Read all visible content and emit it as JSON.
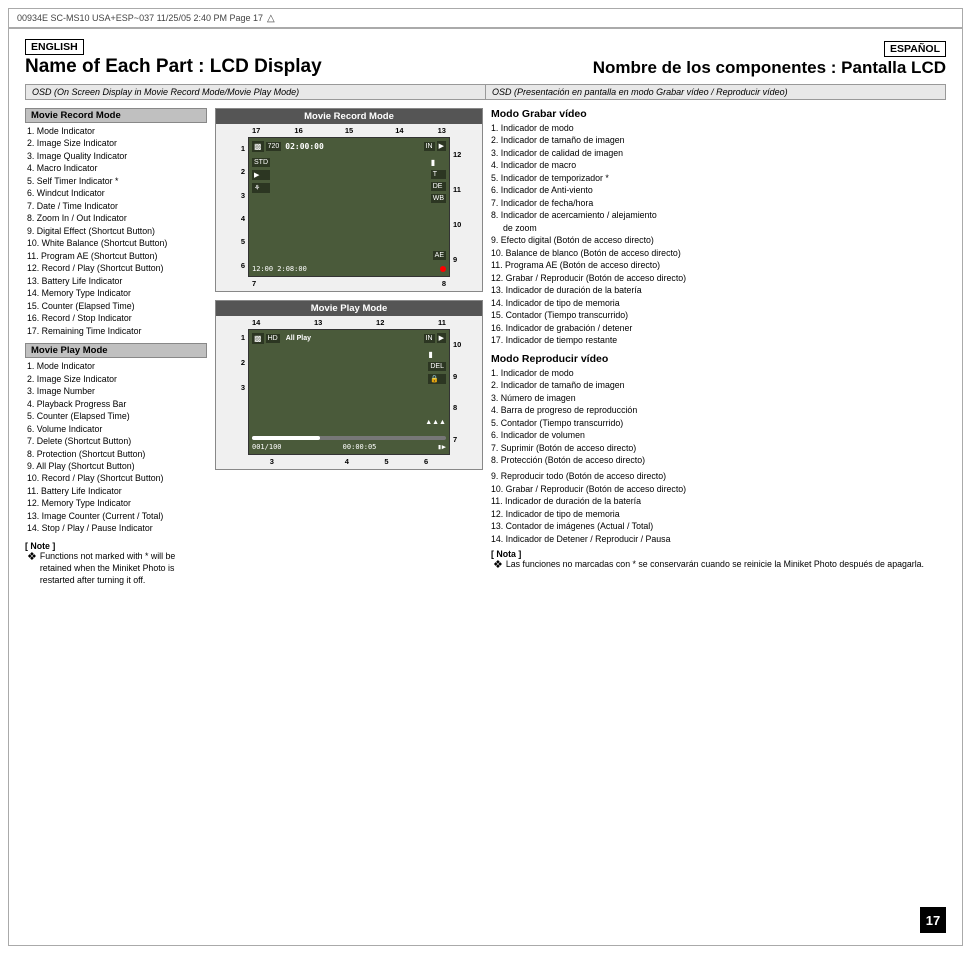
{
  "header": {
    "meta": "00934E SC-MS10 USA+ESP~037   11/25/05  2:40 PM    Page 17"
  },
  "page": {
    "lang_en": "ENGLISH",
    "lang_es": "ESPAÑOL",
    "title_en": "Name of Each Part : LCD Display",
    "title_es": "Nombre de los componentes : Pantalla LCD",
    "osd_en": "OSD (On Screen Display in Movie Record Mode/Movie Play Mode)",
    "osd_es": "OSD (Presentación en pantalla en modo Grabar vídeo / Reproducir vídeo)"
  },
  "movie_record_mode": {
    "title": "Movie Record Mode",
    "items": [
      "1.  Mode Indicator",
      "2.  Image Size Indicator",
      "3.  Image Quality Indicator",
      "4.  Macro Indicator",
      "5.  Self Timer Indicator *",
      "6.  Windcut Indicator",
      "7.  Date / Time Indicator",
      "8.  Zoom In / Out Indicator",
      "9.   Digital Effect (Shortcut Button)",
      "10. White Balance (Shortcut Button)",
      "11. Program AE (Shortcut Button)",
      "12. Record / Play (Shortcut Button)",
      "13. Battery Life Indicator",
      "14. Memory Type Indicator",
      "15. Counter (Elapsed Time)",
      "16. Record / Stop Indicator",
      "17. Remaining Time Indicator"
    ]
  },
  "movie_play_mode": {
    "title": "Movie Play Mode",
    "items": [
      "1.  Mode Indicator",
      "2.  Image Size Indicator",
      "3.  Image Number",
      "4.  Playback Progress Bar",
      "5.  Counter (Elapsed Time)",
      "6.  Volume Indicator",
      "7.  Delete (Shortcut Button)",
      "8.  Protection (Shortcut Button)",
      "9.  All Play (Shortcut Button)",
      "10. Record / Play (Shortcut Button)",
      "11. Battery Life Indicator",
      "12. Memory Type Indicator",
      "13. Image Counter (Current / Total)",
      "14. Stop / Play / Pause Indicator"
    ]
  },
  "note_en": {
    "title": "[ Note ]",
    "text": "Functions not marked with * will be retained when the Miniket Photo is restarted after turning it off."
  },
  "modo_grabar": {
    "title": "Modo Grabar vídeo",
    "items": [
      "1.  Indicador de modo",
      "2.  Indicador de tamaño de imagen",
      "3.  Indicador de calidad de imagen",
      "4.  Indicador de macro",
      "5.  Indicador de temporizador *",
      "6.  Indicador de Anti-viento",
      "7.  Indicador de fecha/hora",
      "8.  Indicador de acercamiento / alejamiento de zoom",
      "9.  Efecto digital (Botón de acceso directo)",
      "10. Balance de blanco (Botón de acceso directo)",
      "11. Programa AE (Botón de acceso directo)",
      "12. Grabar / Reproducir (Botón de acceso directo)",
      "13. Indicador de duración de la batería",
      "14. Indicador de tipo de memoria",
      "15. Contador (Tiempo transcurrido)",
      "16. Indicador de grabación / detener",
      "17. Indicador de tiempo restante"
    ]
  },
  "modo_reproducir": {
    "title": "Modo Reproducir vídeo",
    "items": [
      "1.  Indicador de modo",
      "2.  Indicador de tamaño de imagen",
      "3.  Número de imagen",
      "4.  Barra de progreso de reproducción",
      "5.  Contador (Tiempo transcurrido)",
      "6.  Indicador de volumen",
      "7.  Suprimir (Botón de acceso directo)",
      "8.  Protección (Botón de acceso directo)"
    ]
  },
  "modo_reproducir_extra": [
    "9.   Reproducir todo (Botón de acceso directo)",
    "10. Grabar / Reproducir (Botón de acceso directo)",
    "11. Indicador de duración de la batería",
    "12. Indicador de tipo de memoria",
    "13. Contador de imágenes (Actual / Total)",
    "14. Indicador de Detener / Reproducir / Pausa"
  ],
  "nota_es": {
    "title": "[ Nota ]",
    "text": "Las funciones no marcadas con * se conservarán cuando se reinicie la Miniket Photo después de apagarla."
  },
  "page_number": "17",
  "lcd_record": {
    "title": "Movie Record Mode",
    "top_nums": "17 16   15    14  13",
    "right_nums": [
      "12",
      "11",
      "10",
      "9"
    ],
    "left_nums": [
      "1",
      "2",
      "3",
      "4",
      "5",
      "6"
    ],
    "bottom_nums": [
      "7",
      "",
      "",
      "8"
    ],
    "timecode": "02:00:00",
    "remaining": "12:00 2:08:00"
  },
  "lcd_play": {
    "title": "Movie Play Mode",
    "top_nums": "14   13  12  11",
    "right_nums": [
      "10",
      "9",
      "8",
      "7"
    ],
    "left_nums": [
      "1",
      "2"
    ],
    "bottom_nums": [
      "3",
      "",
      "4",
      "5",
      "6"
    ],
    "label_allplay": "All Play"
  }
}
